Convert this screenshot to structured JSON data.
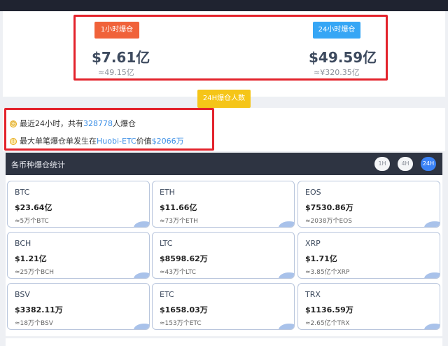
{
  "topbar": {
    "title": ""
  },
  "summary": {
    "one_hour": {
      "tab_label": "1小时爆仓",
      "amount": "$7.61亿",
      "sub": "≈49.15亿"
    },
    "twenty_four_hour": {
      "tab_label": "24小时爆仓",
      "amount": "$49.59亿",
      "sub": "≈¥320.35亿"
    }
  },
  "people_tab": {
    "label": "24H爆仓人数"
  },
  "info": {
    "line1": {
      "prefix": "最近24小时，共有",
      "count": "328778",
      "suffix": "人爆仓"
    },
    "line2": {
      "prefix": "最大单笔爆仓单发生在",
      "market": "Huobi-ETC",
      "middle": "价值",
      "value": "$2066万"
    }
  },
  "section": {
    "title": "各币种爆仓统计",
    "timeframes": [
      "1H",
      "4H",
      "24H"
    ],
    "selected_timeframe": "24H"
  },
  "coins": [
    {
      "symbol": "BTC",
      "amount": "$23.64亿",
      "qty": "≈5万个BTC"
    },
    {
      "symbol": "ETH",
      "amount": "$11.66亿",
      "qty": "≈73万个ETH"
    },
    {
      "symbol": "EOS",
      "amount": "$7530.86万",
      "qty": "≈2038万个EOS"
    },
    {
      "symbol": "BCH",
      "amount": "$1.21亿",
      "qty": "≈25万个BCH"
    },
    {
      "symbol": "LTC",
      "amount": "$8598.62万",
      "qty": "≈43万个LTC"
    },
    {
      "symbol": "XRP",
      "amount": "$1.71亿",
      "qty": "≈3.85亿个XRP"
    },
    {
      "symbol": "BSV",
      "amount": "$3382.11万",
      "qty": "≈18万个BSV"
    },
    {
      "symbol": "ETC",
      "amount": "$1658.03万",
      "qty": "≈153万个ETC"
    },
    {
      "symbol": "TRX",
      "amount": "$1136.59万",
      "qty": "≈2.65亿个TRX"
    }
  ],
  "colors": {
    "highlight_red": "#e3232c",
    "tab_1h": "#f0623a",
    "tab_24h": "#36a6f5",
    "people_tab": "#f5c518",
    "link_blue": "#3a8ee6",
    "section_header": "#2e3442",
    "active_timeframe": "#3b82f6"
  }
}
